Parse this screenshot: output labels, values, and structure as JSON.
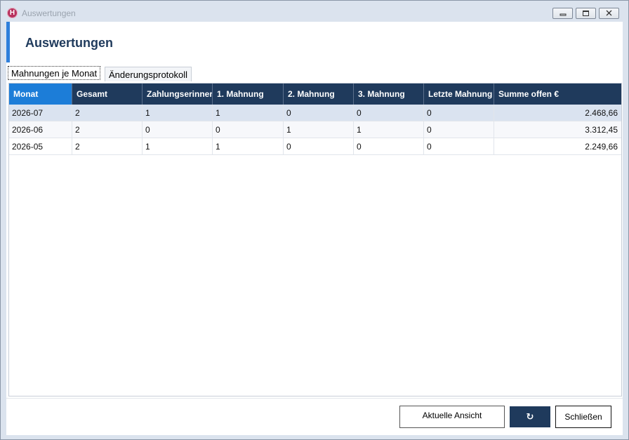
{
  "window": {
    "title": "Auswertungen",
    "app_icon_letter": "H"
  },
  "page": {
    "title": "Auswertungen",
    "accent_color": "#2f7fdb",
    "header_color": "#1f3a5c"
  },
  "tabs": [
    {
      "label": "Mahnungen je Monat",
      "active": true
    },
    {
      "label": "Änderungsprotokoll",
      "active": false
    }
  ],
  "table": {
    "columns": [
      "Monat",
      "Gesamt",
      "Zahlungserinnerung",
      "1. Mahnung",
      "2. Mahnung",
      "3. Mahnung",
      "Letzte Mahnung",
      "Summe offen €"
    ],
    "rows": [
      [
        "2026-07",
        "2",
        "1",
        "1",
        "0",
        "0",
        "0",
        "2.468,66"
      ],
      [
        "2026-06",
        "2",
        "0",
        "0",
        "1",
        "1",
        "0",
        "3.312,45"
      ],
      [
        "2026-05",
        "2",
        "1",
        "1",
        "0",
        "0",
        "0",
        "2.249,66"
      ]
    ]
  },
  "buttons": {
    "current_view": "Aktuelle Ansicht",
    "refresh": "↻",
    "close": "Schließen"
  }
}
